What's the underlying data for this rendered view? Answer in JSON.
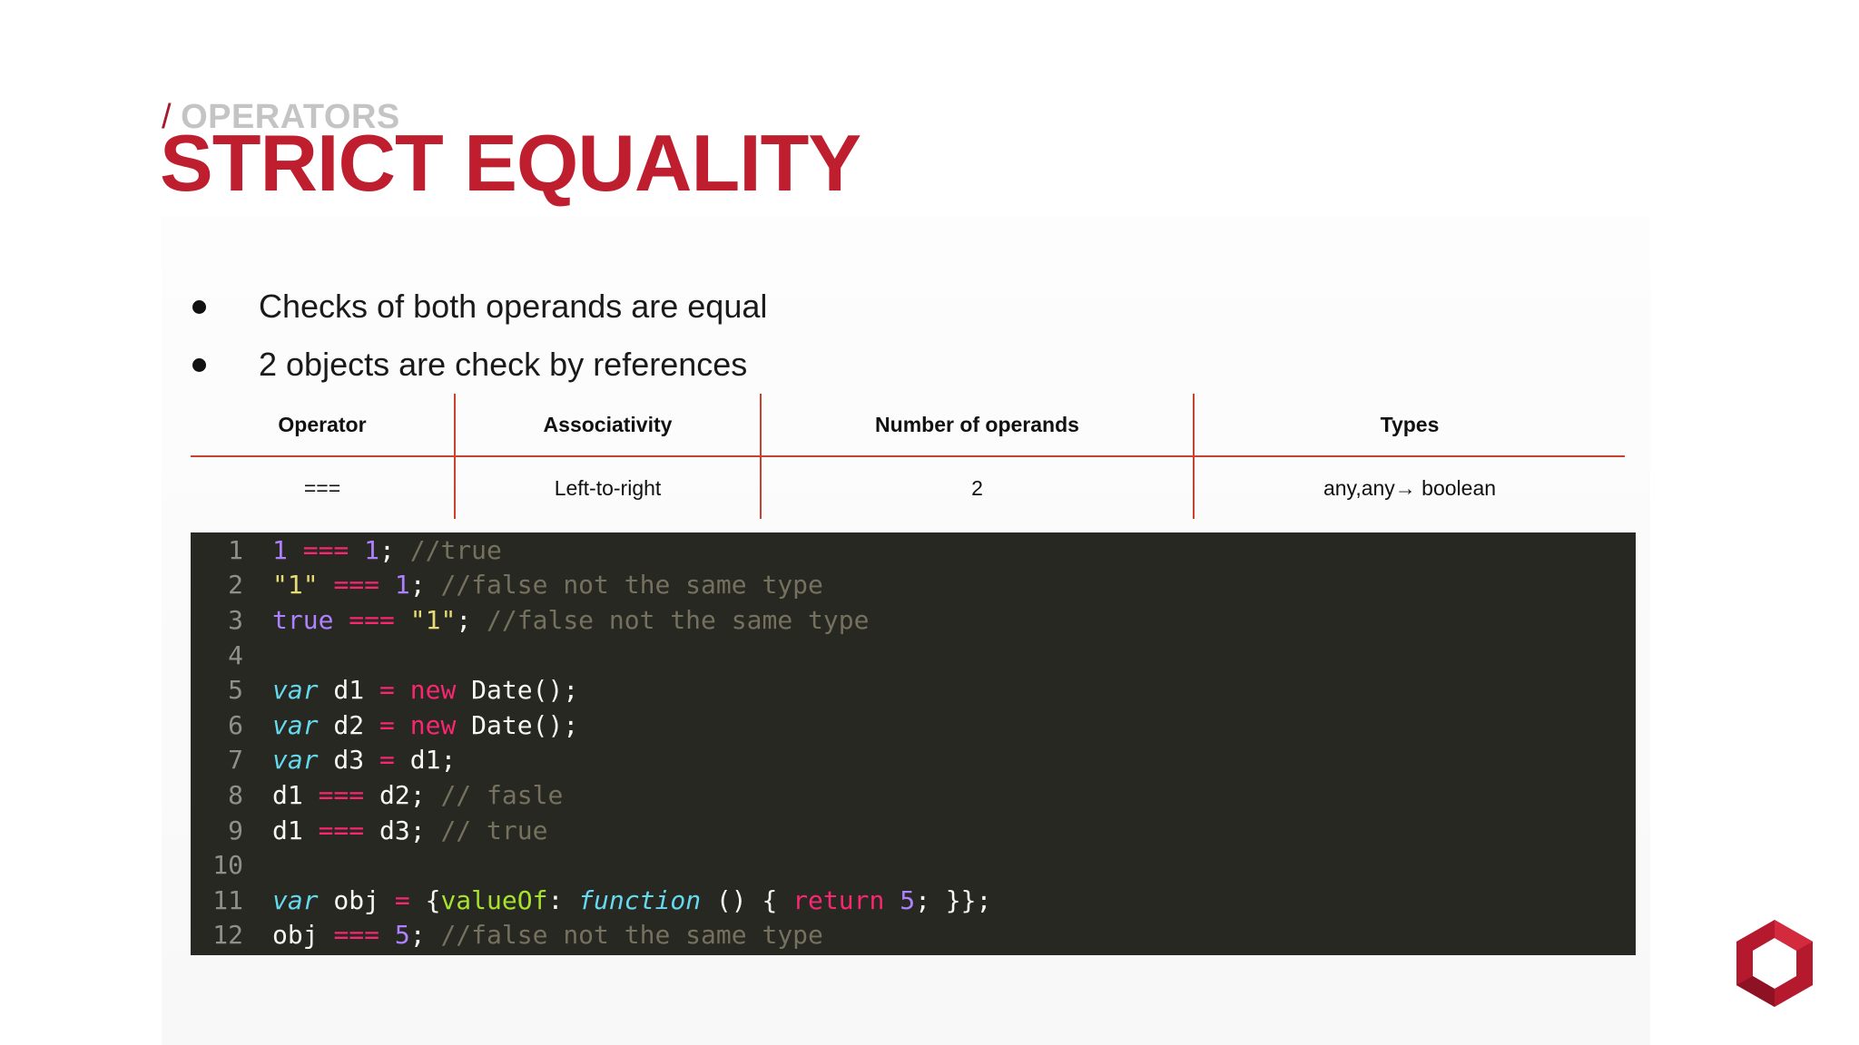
{
  "header": {
    "breadcrumb_slash": "/",
    "breadcrumb": "OPERATORS",
    "title": "STRICT EQUALITY"
  },
  "bullets": [
    "Checks of both operands are equal",
    "2 objects are check by references"
  ],
  "table": {
    "headers": [
      "Operator",
      "Associativity",
      "Number of operands",
      "Types"
    ],
    "rows": [
      [
        "===",
        "Left-to-right",
        "2",
        "any,any→ boolean"
      ]
    ]
  },
  "code": {
    "line_numbers": [
      "1",
      "2",
      "3",
      "4",
      "5",
      "6",
      "7",
      "8",
      "9",
      "10",
      "11",
      "12"
    ],
    "lines": [
      [
        [
          "num",
          "1"
        ],
        [
          "plain",
          " "
        ],
        [
          "op",
          "==="
        ],
        [
          "plain",
          " "
        ],
        [
          "num",
          "1"
        ],
        [
          "plain",
          "; "
        ],
        [
          "cmt",
          "//true"
        ]
      ],
      [
        [
          "str",
          "\"1\""
        ],
        [
          "plain",
          " "
        ],
        [
          "op",
          "==="
        ],
        [
          "plain",
          " "
        ],
        [
          "num",
          "1"
        ],
        [
          "plain",
          "; "
        ],
        [
          "cmt",
          "//false not the same type"
        ]
      ],
      [
        [
          "bool",
          "true"
        ],
        [
          "plain",
          " "
        ],
        [
          "op",
          "==="
        ],
        [
          "plain",
          " "
        ],
        [
          "str",
          "\"1\""
        ],
        [
          "plain",
          "; "
        ],
        [
          "cmt",
          "//false not the same type"
        ]
      ],
      [],
      [
        [
          "kw",
          "var"
        ],
        [
          "plain",
          " d1 "
        ],
        [
          "op",
          "="
        ],
        [
          "plain",
          " "
        ],
        [
          "new",
          "new"
        ],
        [
          "plain",
          " Date();"
        ]
      ],
      [
        [
          "kw",
          "var"
        ],
        [
          "plain",
          " d2 "
        ],
        [
          "op",
          "="
        ],
        [
          "plain",
          " "
        ],
        [
          "new",
          "new"
        ],
        [
          "plain",
          " Date();"
        ]
      ],
      [
        [
          "kw",
          "var"
        ],
        [
          "plain",
          " d3 "
        ],
        [
          "op",
          "="
        ],
        [
          "plain",
          " d1;"
        ]
      ],
      [
        [
          "plain",
          "d1 "
        ],
        [
          "op",
          "==="
        ],
        [
          "plain",
          " d2; "
        ],
        [
          "cmt",
          "// fasle"
        ]
      ],
      [
        [
          "plain",
          "d1 "
        ],
        [
          "op",
          "==="
        ],
        [
          "plain",
          " d3; "
        ],
        [
          "cmt",
          "// true"
        ]
      ],
      [],
      [
        [
          "kw",
          "var"
        ],
        [
          "plain",
          " obj "
        ],
        [
          "op",
          "="
        ],
        [
          "plain",
          " {"
        ],
        [
          "prop",
          "valueOf"
        ],
        [
          "plain",
          ": "
        ],
        [
          "fn",
          "function"
        ],
        [
          "plain",
          " () { "
        ],
        [
          "ret",
          "return"
        ],
        [
          "plain",
          " "
        ],
        [
          "num",
          "5"
        ],
        [
          "plain",
          "; }};"
        ]
      ],
      [
        [
          "plain",
          "obj "
        ],
        [
          "op",
          "==="
        ],
        [
          "plain",
          " "
        ],
        [
          "num",
          "5"
        ],
        [
          "plain",
          "; "
        ],
        [
          "cmt",
          "//false not the same type"
        ]
      ]
    ]
  },
  "colors": {
    "brand_red": "#bf1e2e",
    "table_rule": "#c8432f",
    "code_bg": "#272822"
  },
  "logo": {
    "icon": "hexagon-logo-icon"
  }
}
